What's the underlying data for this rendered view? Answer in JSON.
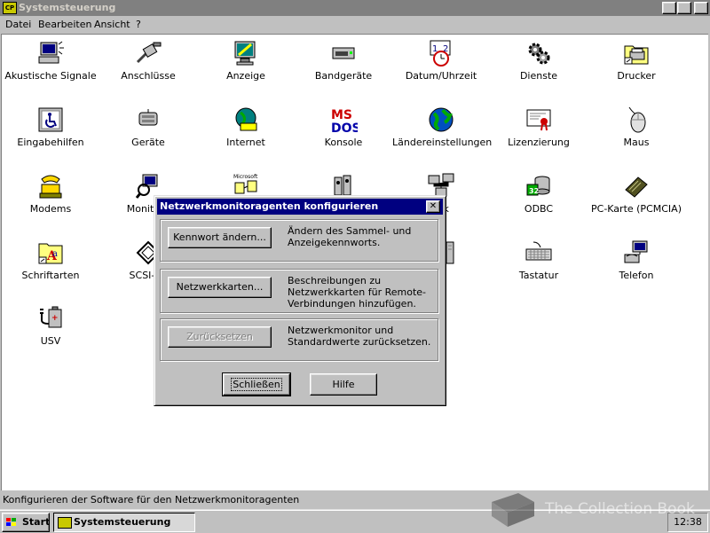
{
  "window": {
    "title": "Systemsteuerung",
    "app_icon": "control-panel-icon",
    "controls": {
      "minimize": "_",
      "maximize": "□",
      "close": "✕"
    }
  },
  "menu": [
    {
      "label": "Datei"
    },
    {
      "label": "Bearbeiten"
    },
    {
      "label": "Ansicht"
    },
    {
      "label": "?"
    }
  ],
  "icons": [
    {
      "label": "Akustische Signale",
      "icon": "sound-icon"
    },
    {
      "label": "Anschlüsse",
      "icon": "connector-icon"
    },
    {
      "label": "Anzeige",
      "icon": "display-icon"
    },
    {
      "label": "Bandgeräte",
      "icon": "tape-drive-icon"
    },
    {
      "label": "Datum/Uhrzeit",
      "icon": "calendar-clock-icon"
    },
    {
      "label": "Dienste",
      "icon": "gears-icon"
    },
    {
      "label": "Drucker",
      "icon": "printer-folder-icon"
    },
    {
      "label": "Eingabehilfen",
      "icon": "accessibility-icon"
    },
    {
      "label": "Geräte",
      "icon": "devices-icon"
    },
    {
      "label": "Internet",
      "icon": "globe-phone-icon"
    },
    {
      "label": "Konsole",
      "icon": "msdos-icon"
    },
    {
      "label": "Ländereinstellungen",
      "icon": "globe-icon"
    },
    {
      "label": "Lizenzierung",
      "icon": "certificate-icon"
    },
    {
      "label": "Maus",
      "icon": "mouse-icon"
    },
    {
      "label": "Modems",
      "icon": "modem-phone-icon"
    },
    {
      "label": "Monitora",
      "icon": "monitor-agent-icon"
    },
    {
      "label": "",
      "icon": "microsoft-mail-icon"
    },
    {
      "label": "",
      "icon": "multimedia-icon"
    },
    {
      "label": "erk",
      "icon": "network-icon"
    },
    {
      "label": "ODBC",
      "icon": "odbc-icon"
    },
    {
      "label": "PC-Karte (PCMCIA)",
      "icon": "pc-card-icon"
    },
    {
      "label": "Schriftarten",
      "icon": "fonts-folder-icon"
    },
    {
      "label": "SCSI-Ad",
      "icon": "scsi-icon"
    },
    {
      "label": "m",
      "icon": "server-icon"
    },
    {
      "label": "Tastatur",
      "icon": "keyboard-icon"
    },
    {
      "label": "Telefon",
      "icon": "telephony-icon"
    },
    {
      "label": "USV",
      "icon": "ups-icon"
    }
  ],
  "dialog": {
    "title": "Netzwerkmonitoragenten konfigurieren",
    "groups": [
      {
        "button": "Kennwort ändern...",
        "description": "Ändern des Sammel- und Anzeigekennworts.",
        "enabled": true
      },
      {
        "button": "Netzwerkkarten...",
        "description": "Beschreibungen zu Netzwerkkarten für Remote-Verbindungen hinzufügen.",
        "enabled": true
      },
      {
        "button": "Zurücksetzen",
        "description": "Netzwerkmonitor und Standardwerte zurücksetzen.",
        "enabled": false
      }
    ],
    "close_button": "Schließen",
    "help_button": "Hilfe"
  },
  "statusbar": {
    "text": "Konfigurieren der Software für den Netzwerkmonitoragenten"
  },
  "taskbar": {
    "start_label": "Start",
    "task_label": "Systemsteuerung",
    "clock": "12:38"
  },
  "watermark": {
    "text": "The Collection Book"
  }
}
